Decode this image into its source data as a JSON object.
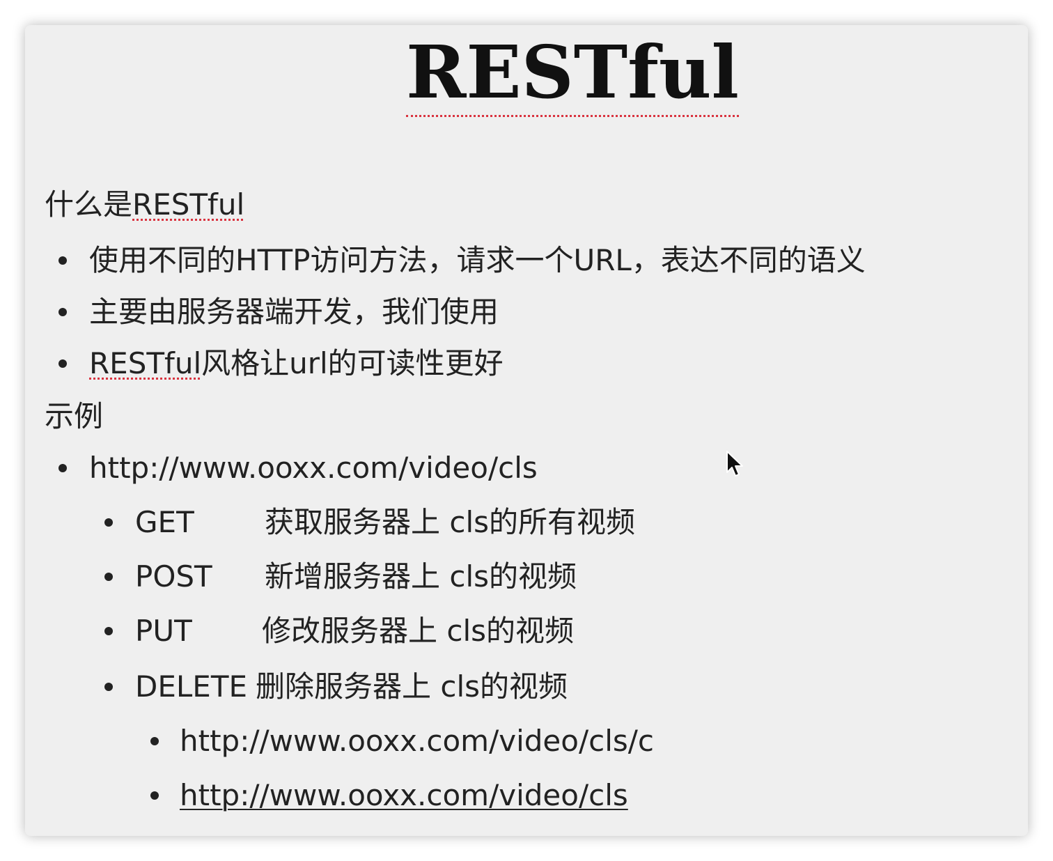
{
  "slide": {
    "title": "RESTful",
    "section1": {
      "heading_prefix": "什么是",
      "heading_term": "RESTful",
      "bullets": [
        {
          "text": "使用不同的HTTP访问方法，请求一个URL，表达不同的语义"
        },
        {
          "text": "主要由服务器端开发，我们使用"
        },
        {
          "term": "RESTful",
          "text": "风格让url的可读性更好"
        }
      ]
    },
    "section2": {
      "heading": "示例",
      "url": "http://www.ooxx.com/video/cls",
      "methods": [
        {
          "method": "GET",
          "desc": "获取服务器上 cls的所有视频"
        },
        {
          "method": "POST",
          "desc": "新增服务器上 cls的视频"
        },
        {
          "method": "PUT",
          "desc": "修改服务器上 cls的视频"
        },
        {
          "method": "DELETE",
          "desc": "删除服务器上 cls的视频"
        }
      ],
      "sub_urls": [
        "http://www.ooxx.com/video/cls/c",
        "http://www.ooxx.com/video/cls"
      ]
    }
  },
  "colors": {
    "slide_bg": "#efefef",
    "text": "#222222",
    "spellcheck": "#d9333f"
  },
  "icons": {
    "cursor": "mouse-pointer-icon"
  }
}
